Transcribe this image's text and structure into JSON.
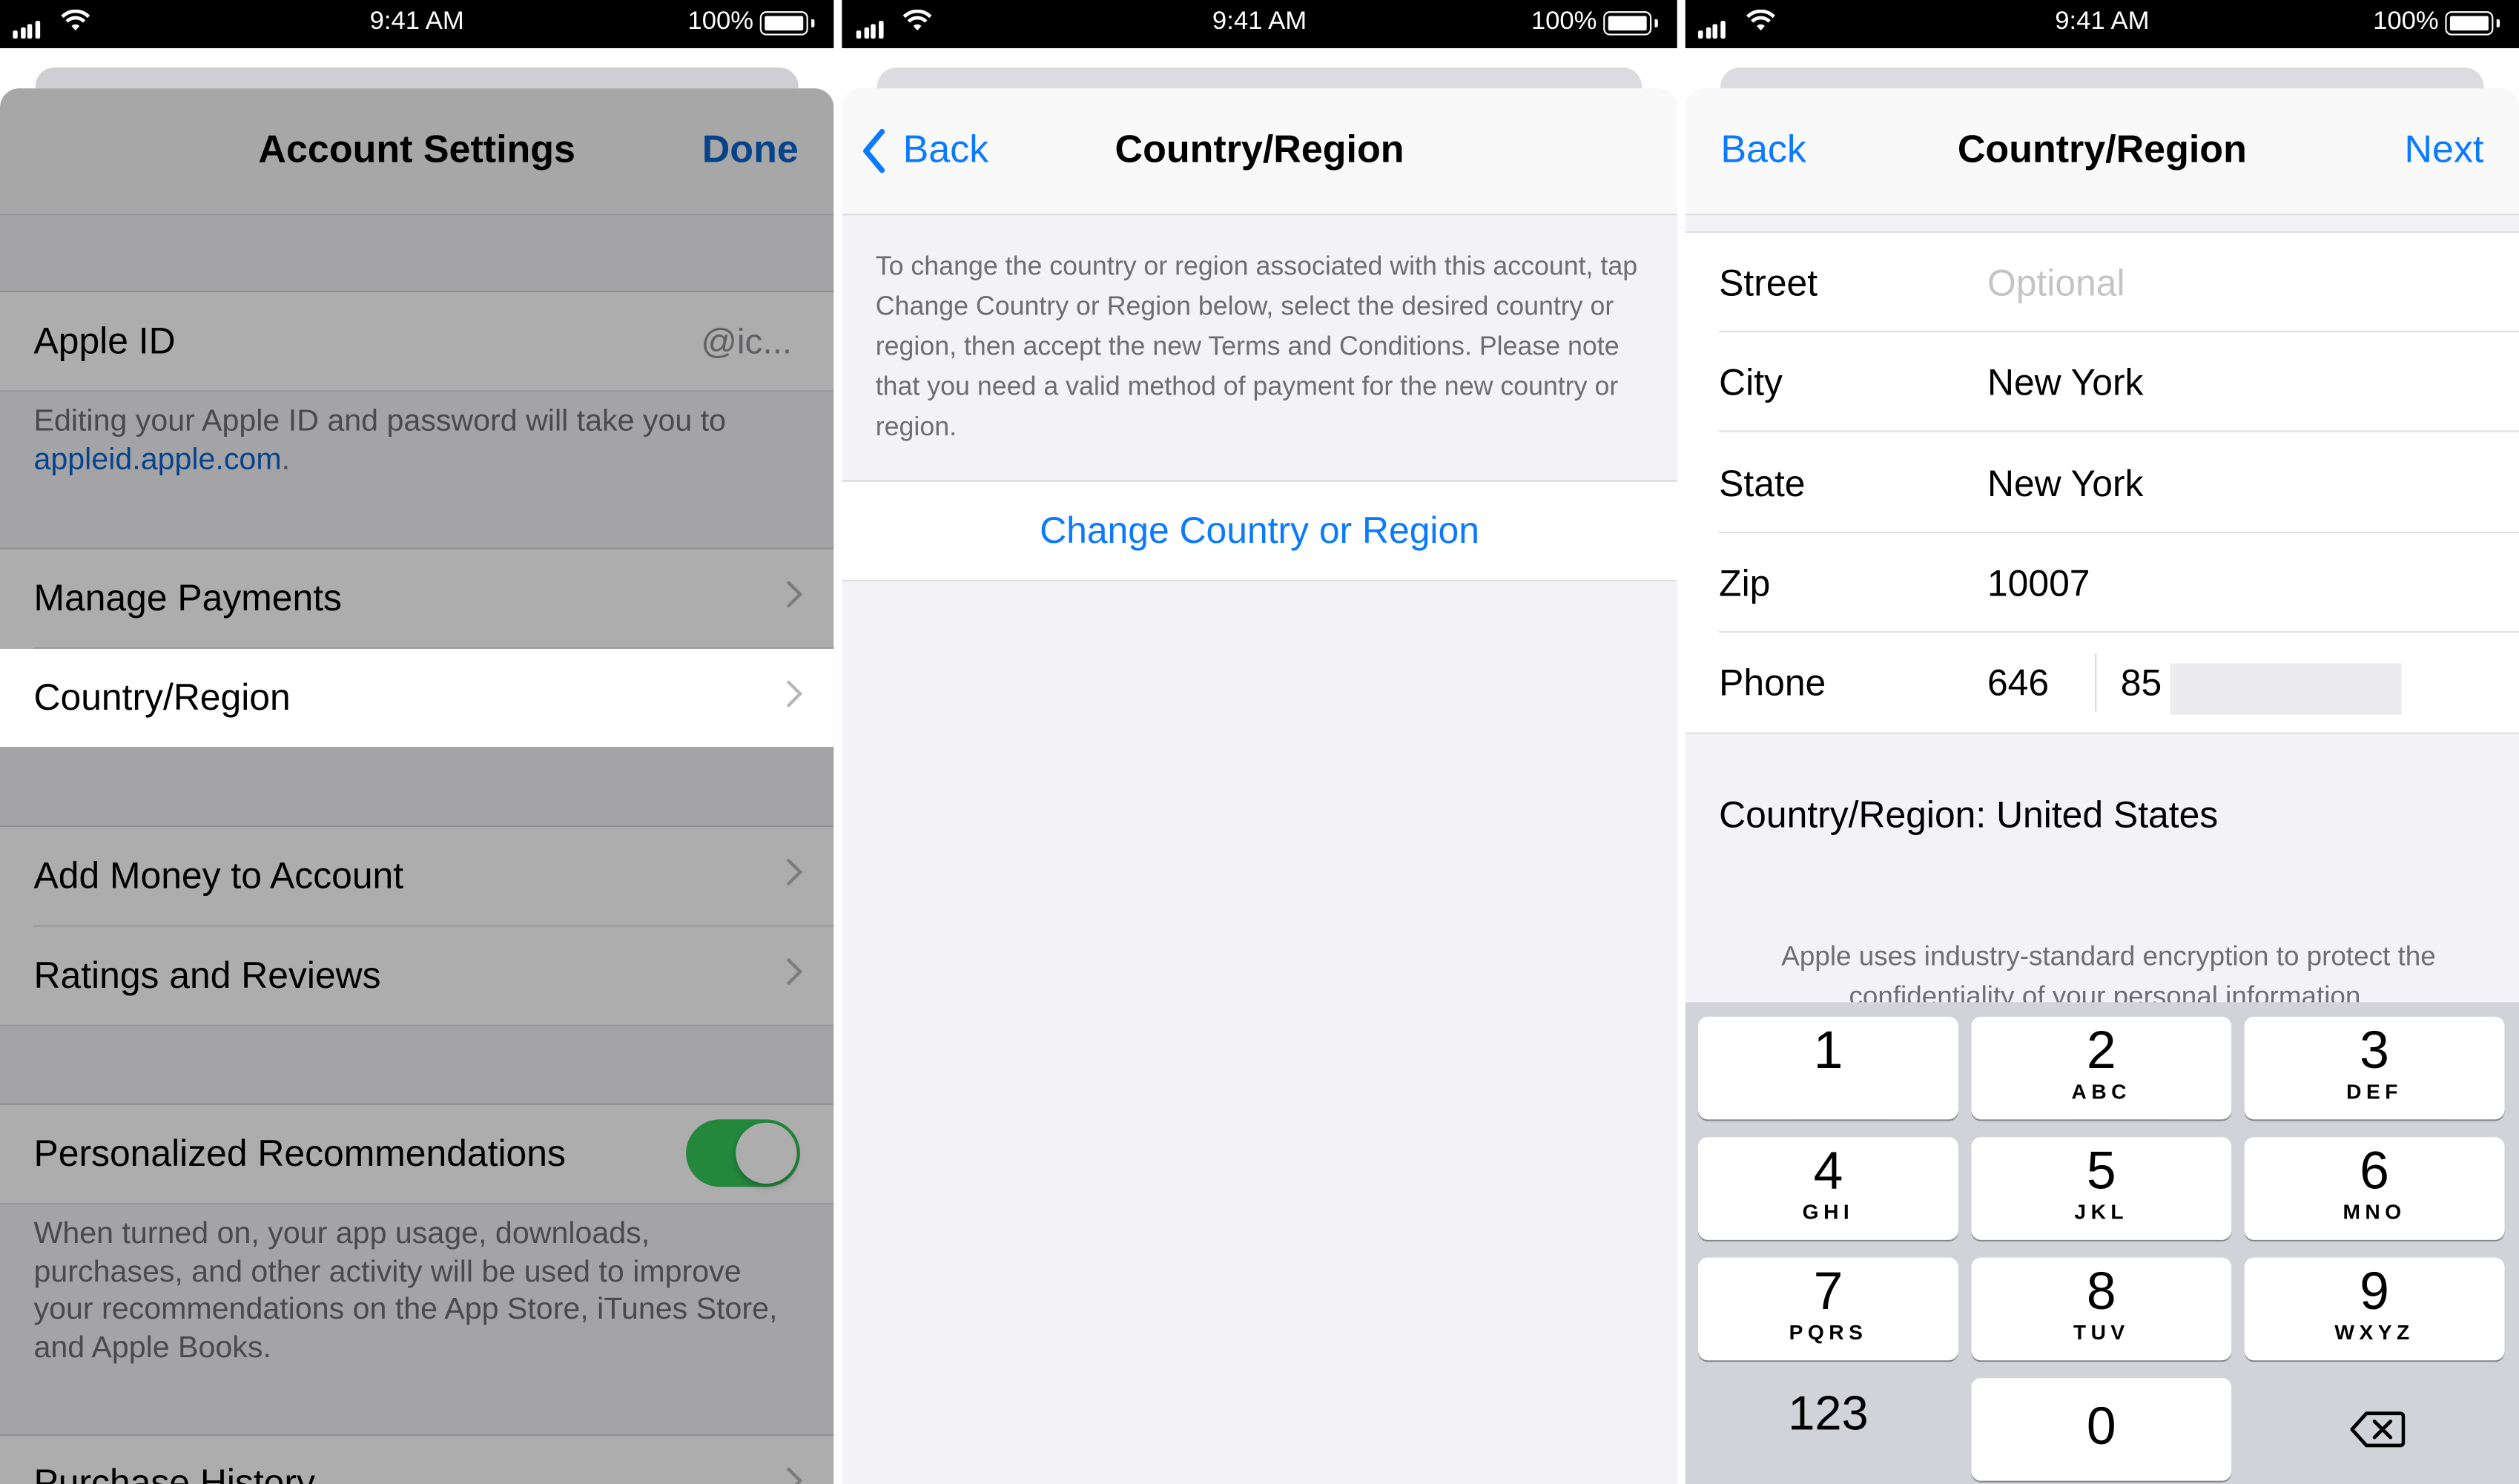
{
  "status_bar": {
    "time": "9:41 AM",
    "battery": "100%"
  },
  "panel1": {
    "title": "Account Settings",
    "done": "Done",
    "apple_id": {
      "label": "Apple ID",
      "value": "@ic..."
    },
    "apple_id_note_prefix": "Editing your Apple ID and password will take you to",
    "apple_id_note_link": "appleid.apple.com",
    "apple_id_note_suffix": ".",
    "items": [
      {
        "label": "Manage Payments"
      },
      {
        "label": "Country/Region"
      },
      {
        "label": "Add Money to Account"
      },
      {
        "label": "Ratings and Reviews"
      }
    ],
    "personalized": {
      "label": "Personalized Recommendations",
      "enabled": true
    },
    "personalized_note": "When turned on, your app usage, downloads, purchases, and other activity will be used to improve your recommendations on the App Store, iTunes Store, and Apple Books.",
    "purchase_history": "Purchase History"
  },
  "panel2": {
    "back": "Back",
    "title": "Country/Region",
    "info": "To change the country or region associated with this account, tap Change Country or Region below, select the desired country or region, then accept the new Terms and Conditions. Please note that you need a valid method of payment for the new country or region.",
    "change_button": "Change Country or Region"
  },
  "panel3": {
    "back": "Back",
    "title": "Country/Region",
    "next": "Next",
    "street": {
      "label": "Street",
      "placeholder": "Optional"
    },
    "city": {
      "label": "City",
      "value": "New York"
    },
    "state": {
      "label": "State",
      "value": "New York"
    },
    "zip": {
      "label": "Zip",
      "value": "10007"
    },
    "phone": {
      "label": "Phone",
      "area": "646",
      "number": "85"
    },
    "country_line": "Country/Region: United States",
    "encryption_note": "Apple uses industry-standard encryption to protect the confidentiality of your personal information.",
    "keypad": [
      {
        "num": "1",
        "letters": ""
      },
      {
        "num": "2",
        "letters": "ABC"
      },
      {
        "num": "3",
        "letters": "DEF"
      },
      {
        "num": "4",
        "letters": "GHI"
      },
      {
        "num": "5",
        "letters": "JKL"
      },
      {
        "num": "6",
        "letters": "MNO"
      },
      {
        "num": "7",
        "letters": "PQRS"
      },
      {
        "num": "8",
        "letters": "TUV"
      },
      {
        "num": "9",
        "letters": "WXYZ"
      },
      {
        "num": "0",
        "letters": ""
      }
    ],
    "key_123": "123"
  }
}
